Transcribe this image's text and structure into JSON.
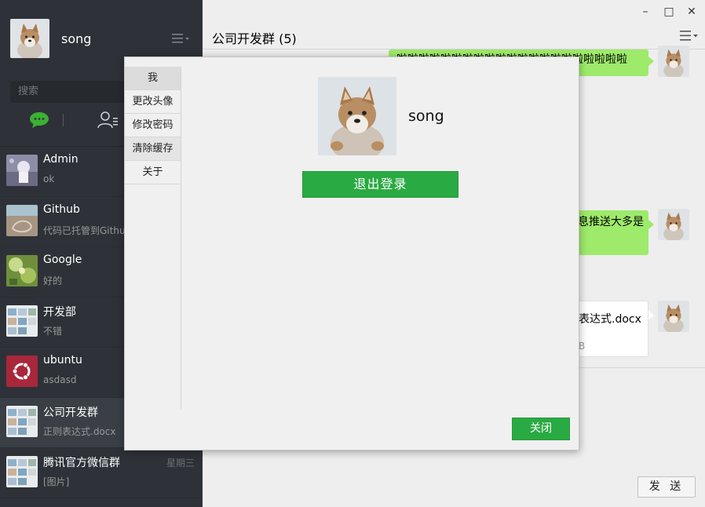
{
  "user": {
    "name": "song"
  },
  "search": {
    "placeholder": "搜索"
  },
  "conversations": [
    {
      "name": "Admin",
      "message": "ok",
      "time": ""
    },
    {
      "name": "Github",
      "message": "代码已托管到Github",
      "time": ""
    },
    {
      "name": "Google",
      "message": "好的",
      "time": ""
    },
    {
      "name": "开发部",
      "message": "不错",
      "time": ""
    },
    {
      "name": "ubuntu",
      "message": "asdasd",
      "time": ""
    },
    {
      "name": "公司开发群",
      "message": "正则表达式.docx",
      "time": ""
    },
    {
      "name": "腾讯官方微信群",
      "message": "[图片]",
      "time": "星期三"
    }
  ],
  "chat": {
    "title": "公司开发群 (5)",
    "messages": [
      {
        "text": "啦啦啦啦啦啦啦啦啦啦啦啦啦啦啦啦啦啦啦啦啦"
      },
      {
        "text": "息推送大多是"
      },
      {
        "file": "表达式.docx",
        "size": "B"
      }
    ],
    "send_label": "发 送"
  },
  "window": {
    "minimize": "–",
    "maximize": "□",
    "close": "✕"
  },
  "modal": {
    "menu": [
      "我",
      "更改头像",
      "修改密码",
      "清除缓存",
      "关于"
    ],
    "profile_name": "song",
    "logout_label": "退出登录",
    "close_label": "关闭"
  },
  "colors": {
    "sidebar": "#2e3238",
    "accent_green": "#2aaa42",
    "bubble_green": "#9eea6a",
    "chat_icon_green": "#3cb034"
  }
}
